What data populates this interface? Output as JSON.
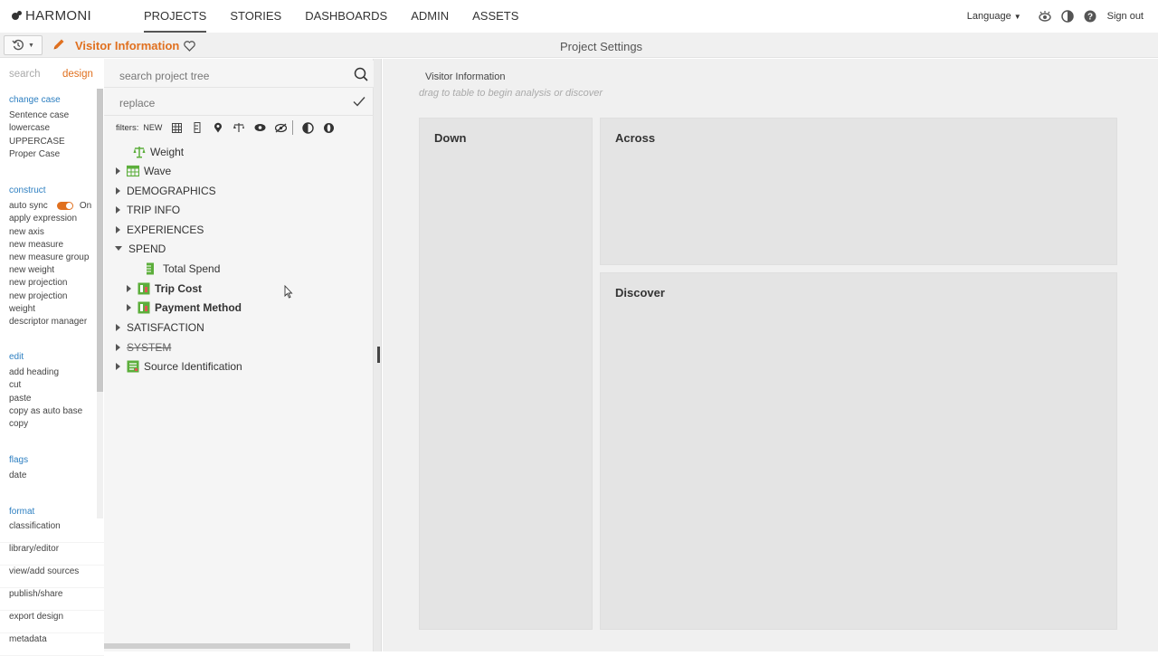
{
  "app": {
    "brand": "HARMONI",
    "nav": [
      "PROJECTS",
      "STORIES",
      "DASHBOARDS",
      "ADMIN",
      "ASSETS"
    ],
    "active_nav": "PROJECTS",
    "language_label": "Language",
    "signout_label": "Sign out"
  },
  "subbar": {
    "doc_title": "Visitor Information",
    "center_title": "Project Settings"
  },
  "left_rail": {
    "tabs": {
      "search": "search",
      "design": "design"
    },
    "change_case": {
      "title": "change case",
      "items": [
        "Sentence case",
        "lowercase",
        "UPPERCASE",
        "Proper Case"
      ]
    },
    "construct": {
      "title": "construct",
      "auto_sync_label": "auto sync",
      "auto_sync_state": "On",
      "items": [
        "apply expression",
        "new axis",
        "new measure",
        "new measure group",
        "new weight",
        "new projection",
        "new projection",
        "weight",
        "descriptor manager"
      ]
    },
    "edit": {
      "title": "edit",
      "items": [
        "add heading",
        "cut",
        "paste",
        "copy as auto base",
        "copy"
      ]
    },
    "flags": {
      "title": "flags",
      "items": [
        "date"
      ]
    },
    "format": {
      "title": "format"
    },
    "bottom_links": [
      "classification",
      "library/editor",
      "view/add sources",
      "publish/share",
      "export design",
      "metadata"
    ]
  },
  "tree_panel": {
    "search_placeholder": "search project tree",
    "replace_placeholder": "replace",
    "filters_label": "filters:",
    "filters_new": "NEW",
    "nodes": [
      {
        "label": "Weight",
        "icon": "scale-icon"
      },
      {
        "label": "Wave",
        "icon": "table-icon"
      },
      {
        "label": "DEMOGRAPHICS"
      },
      {
        "label": "TRIP INFO"
      },
      {
        "label": "EXPERIENCES"
      },
      {
        "label": "SPEND"
      },
      {
        "label": "Total Spend",
        "icon": "measure-icon"
      },
      {
        "label": "Trip Cost",
        "icon": "measure-group-icon"
      },
      {
        "label": "Payment Method",
        "icon": "measure-group-icon"
      },
      {
        "label": "SATISFACTION"
      },
      {
        "label": "SYSTEM"
      },
      {
        "label": "Source Identification",
        "icon": "source-icon"
      }
    ]
  },
  "main": {
    "title": "Visitor Information",
    "hint": "drag to table to begin analysis or discover",
    "zones": {
      "down": "Down",
      "across": "Across",
      "discover": "Discover"
    }
  },
  "colors": {
    "accent": "#e0701f",
    "link": "#2d7fc1",
    "icon_green": "#5cae3b"
  }
}
